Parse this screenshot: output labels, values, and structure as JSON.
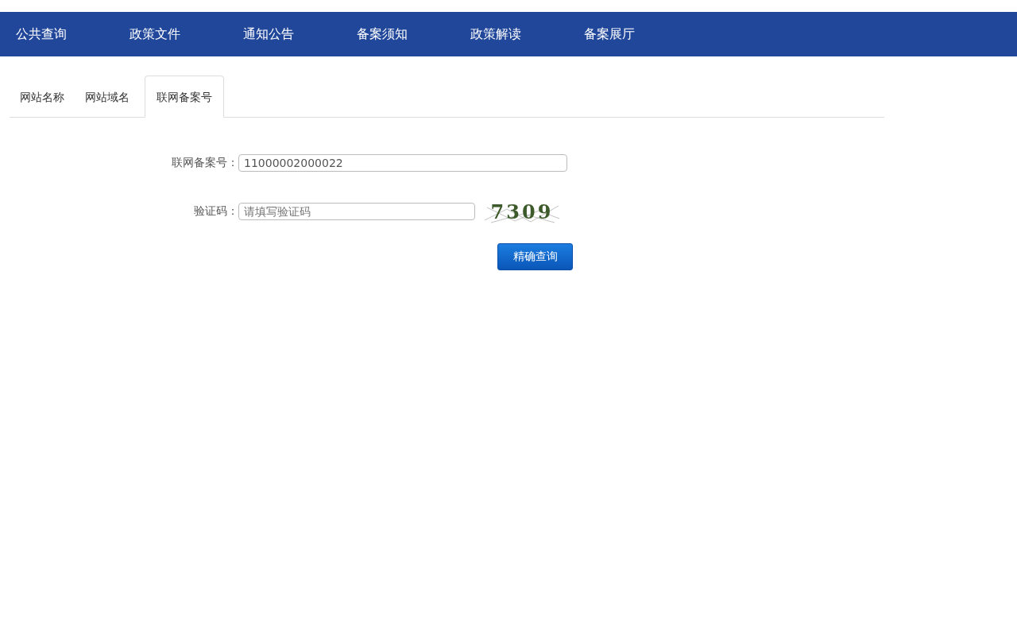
{
  "nav": {
    "items": [
      {
        "label": "公共查询"
      },
      {
        "label": "政策文件"
      },
      {
        "label": "通知公告"
      },
      {
        "label": "备案须知"
      },
      {
        "label": "政策解读"
      },
      {
        "label": "备案展厅"
      }
    ]
  },
  "tabs": [
    {
      "label": "网站名称",
      "selected": false
    },
    {
      "label": "网站域名",
      "selected": false
    },
    {
      "label": "联网备案号",
      "selected": true
    }
  ],
  "form": {
    "record_label": "联网备案号：",
    "record_value": "11000002000022",
    "captcha_label": "验证码：",
    "captcha_placeholder": "请填写验证码",
    "captcha_text": "7309",
    "submit": "精确查询"
  }
}
